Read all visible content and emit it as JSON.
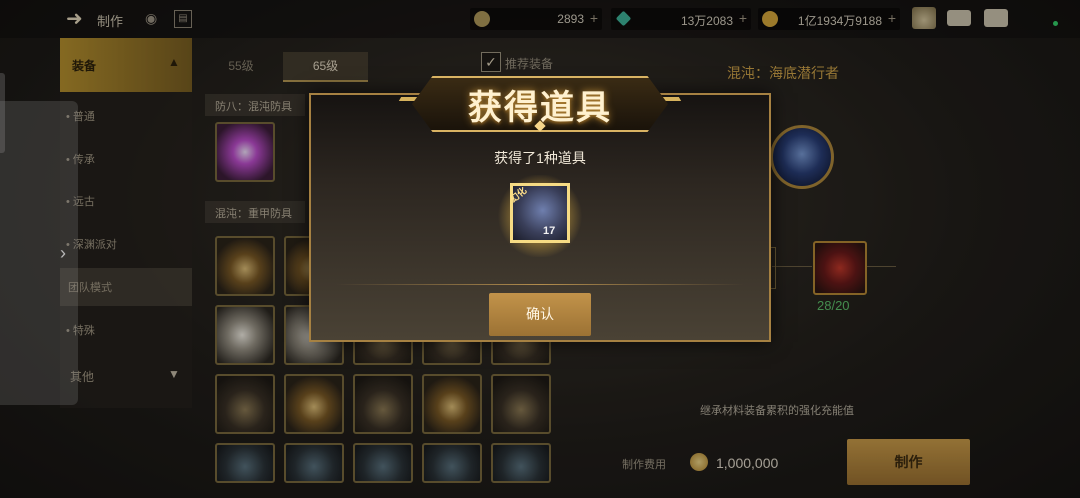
{
  "header": {
    "title": "制作",
    "currencies": [
      {
        "icon": "moon-coin-icon",
        "value": "2893",
        "color": "#b09a5a"
      },
      {
        "icon": "green-crystal-icon",
        "value": "13万2083",
        "color": "#3fb59a"
      },
      {
        "icon": "gold-coin-icon",
        "value": "1亿1934万9188",
        "color": "#d8aa3c"
      }
    ]
  },
  "sidebar": {
    "main": "装备",
    "items": [
      "普通",
      "传承",
      "远古",
      "深渊派对",
      "团队模式",
      "特殊"
    ],
    "other": "其他"
  },
  "tabs": [
    "55级",
    "65级"
  ],
  "filter": {
    "label": "推荐装备",
    "checked": "✓"
  },
  "list": {
    "subhead1": "防八：混沌防具",
    "subhead2": "混沌：重甲防具"
  },
  "detail": {
    "title": "混沌：海底潜行者",
    "material_count": "28/20",
    "description": "继承材料装备累积的强化充能值",
    "cost_label": "制作费用",
    "cost_value": "1,000,000",
    "make_button": "制作"
  },
  "modal": {
    "title": "获得道具",
    "subtitle": "获得了1种道具",
    "item_number": "17",
    "item_tag": "幻化",
    "confirm": "确认"
  }
}
